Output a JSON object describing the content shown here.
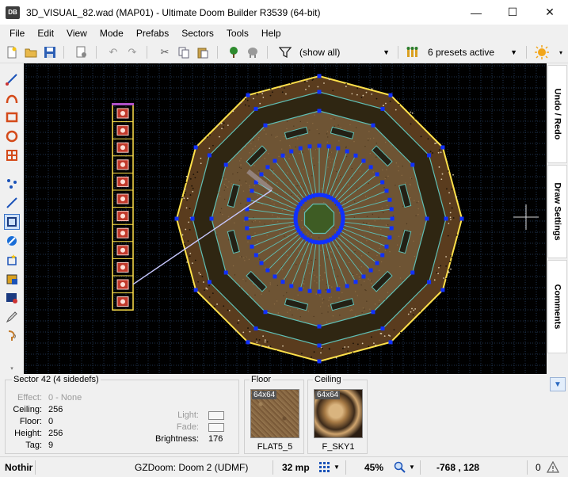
{
  "window": {
    "app_icon": "DB",
    "title": "3D_VISUAL_82.wad (MAP01) - Ultimate Doom Builder R3539 (64-bit)",
    "minimize": "—",
    "maximize": "☐",
    "close": "✕"
  },
  "menu": [
    "File",
    "Edit",
    "View",
    "Mode",
    "Prefabs",
    "Sectors",
    "Tools",
    "Help"
  ],
  "toolbar": {
    "filter_value": "(show all)",
    "presets_value": "6 presets active"
  },
  "side_tabs": [
    "Undo / Redo",
    "Draw Settings",
    "Comments"
  ],
  "sector_info": {
    "title": "Sector 42 (4 sidedefs)",
    "effect_label": "Effect:",
    "effect_value": "0 - None",
    "ceiling_label": "Ceiling:",
    "ceiling_value": "256",
    "floor_label": "Floor:",
    "floor_value": "0",
    "height_label": "Height:",
    "height_value": "256",
    "tag_label": "Tag:",
    "tag_value": "9",
    "light_label": "Light:",
    "fade_label": "Fade:",
    "brightness_label": "Brightness:",
    "brightness_value": "176"
  },
  "floor_texture": {
    "legend": "Floor",
    "size": "64x64",
    "name": "FLAT5_5"
  },
  "ceiling_texture": {
    "legend": "Ceiling",
    "size": "64x64",
    "name": "F_SKY1"
  },
  "collapse_button": "▼",
  "status": {
    "message": "Nothir",
    "game_config": "GZDoom: Doom 2 (UDMF)",
    "grid_size": "32 mp",
    "zoom": "45%",
    "coordinates": "-768 , 128",
    "errors": "0"
  },
  "colors": {
    "map_background": "#000000",
    "grid": "#1f3550",
    "sector_line": "#5fbfb5",
    "outer_wall": "#ffe14a",
    "vertex": "#1030ff",
    "floor_fill": "#6e5434",
    "thing_icon": "#c0392b"
  },
  "icons": {
    "new": "new-map-icon",
    "open": "open-icon",
    "save": "save-icon",
    "undo": "undo-icon",
    "redo": "redo-icon",
    "cut": "cut-icon",
    "copy": "copy-icon",
    "paste": "paste-icon",
    "filter": "filter-icon",
    "light": "sun-icon"
  }
}
